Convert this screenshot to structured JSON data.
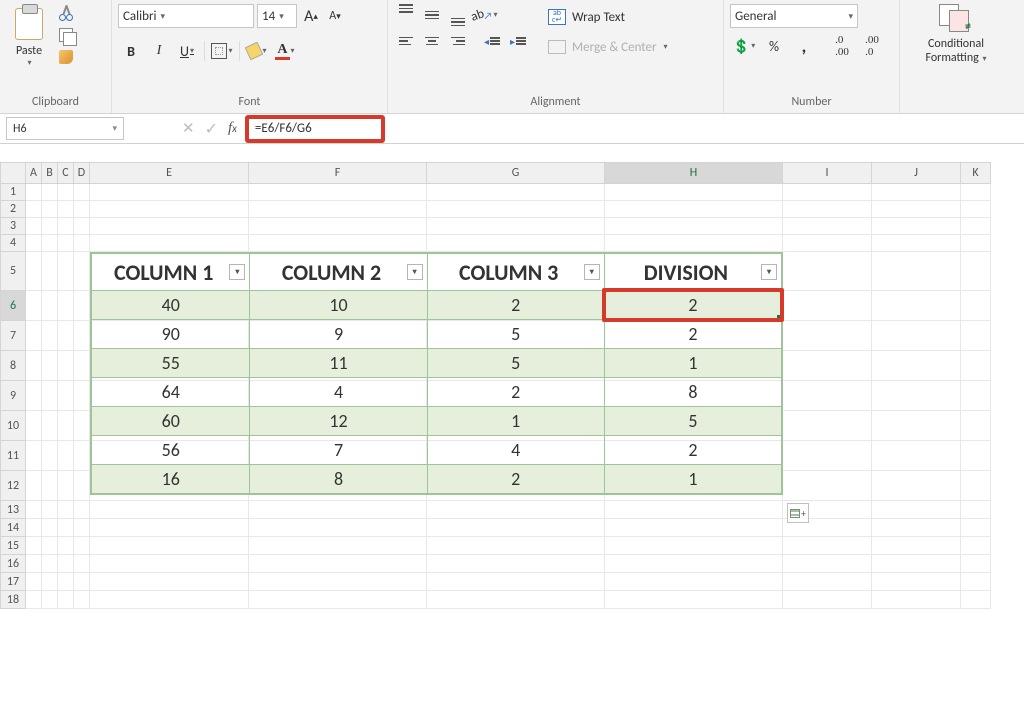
{
  "ribbon": {
    "clipboard": {
      "paste": "Paste",
      "label": "Clipboard"
    },
    "font": {
      "name": "Calibri",
      "size": "14",
      "bold": "B",
      "italic": "I",
      "underline": "U",
      "fontcolor_letter": "A",
      "grow": "A",
      "shrink": "A",
      "label": "Font"
    },
    "alignment": {
      "wrap": "Wrap Text",
      "merge": "Merge & Center",
      "label": "Alignment"
    },
    "number": {
      "format": "General",
      "pct": "%",
      "comma": ",",
      "inc": ".0₀₀",
      "dec": ".0₀",
      "label": "Number"
    },
    "styles": {
      "cond1": "Conditional",
      "cond2": "Formatting"
    }
  },
  "namebox": "H6",
  "formula": "=E6/F6/G6",
  "columns": {
    "A": 16,
    "B": 16,
    "C": 16,
    "D": 16,
    "E": 159,
    "F": 178,
    "G": 178,
    "H": 178,
    "I": 89,
    "J": 89,
    "K": 30
  },
  "rows": {
    "count": 18,
    "heights": {
      "1": 17,
      "2": 17,
      "3": 17,
      "4": 17,
      "5": 39,
      "default": 30,
      "from13": 18
    }
  },
  "table": {
    "headers": [
      "COLUMN 1",
      "COLUMN 2",
      "COLUMN 3",
      "DIVISION"
    ],
    "data": [
      [
        40,
        10,
        2,
        2
      ],
      [
        90,
        9,
        5,
        2
      ],
      [
        55,
        11,
        5,
        1
      ],
      [
        64,
        4,
        2,
        8
      ],
      [
        60,
        12,
        1,
        5
      ],
      [
        56,
        7,
        4,
        2
      ],
      [
        16,
        8,
        2,
        1
      ]
    ]
  },
  "active": {
    "col": "H",
    "row": 6
  },
  "highlight": {
    "col": "H",
    "row": 6
  },
  "chart_data": {
    "type": "table",
    "headers": [
      "COLUMN 1",
      "COLUMN 2",
      "COLUMN 3",
      "DIVISION"
    ],
    "rows": [
      [
        40,
        10,
        2,
        2
      ],
      [
        90,
        9,
        5,
        2
      ],
      [
        55,
        11,
        5,
        1
      ],
      [
        64,
        4,
        2,
        8
      ],
      [
        60,
        12,
        1,
        5
      ],
      [
        56,
        7,
        4,
        2
      ],
      [
        16,
        8,
        2,
        1
      ]
    ]
  }
}
